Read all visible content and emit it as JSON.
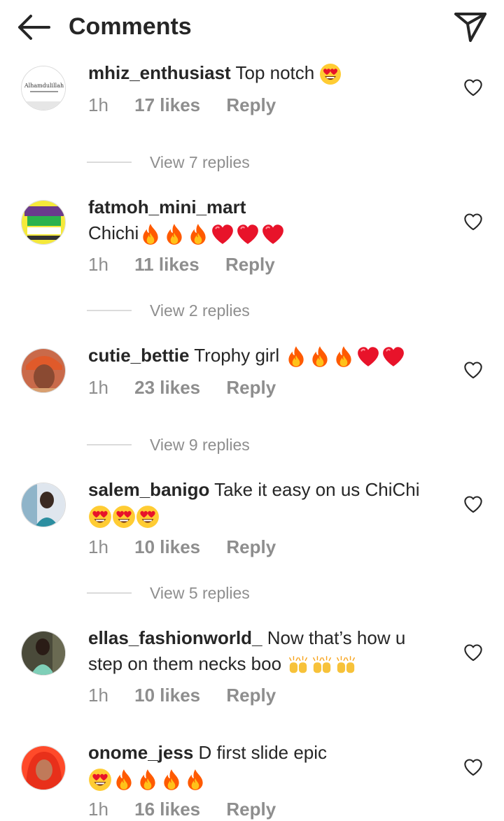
{
  "header": {
    "title": "Comments",
    "back_icon": "arrow-left-icon",
    "send_icon": "paper-plane-icon"
  },
  "comments": [
    {
      "username": "mhiz_enthusiast",
      "text": "Top notch",
      "emojis": [
        "heart-eyes"
      ],
      "time": "1h",
      "likes": "17 likes",
      "reply": "Reply",
      "view_replies": "View 7 replies"
    },
    {
      "username": "fatmoh_mini_mart",
      "text": "Chichi",
      "emojis": [
        "fire",
        "fire",
        "fire",
        "red-heart",
        "red-heart",
        "red-heart"
      ],
      "time": "1h",
      "likes": "11 likes",
      "reply": "Reply",
      "view_replies": "View 2 replies"
    },
    {
      "username": "cutie_bettie",
      "text": "Trophy girl",
      "emojis": [
        "fire",
        "fire",
        "fire",
        "red-heart",
        "red-heart"
      ],
      "time": "1h",
      "likes": "23 likes",
      "reply": "Reply",
      "view_replies": "View 9 replies"
    },
    {
      "username": "salem_banigo",
      "text": "Take it easy on us ChiChi",
      "emojis": [
        "heart-eyes",
        "heart-eyes",
        "heart-eyes"
      ],
      "time": "1h",
      "likes": "10 likes",
      "reply": "Reply",
      "view_replies": "View 5 replies"
    },
    {
      "username": "ellas_fashionworld_",
      "text": "Now that’s how u step on them necks boo",
      "emojis": [
        "raising-hands",
        "raising-hands",
        "raising-hands"
      ],
      "time": "1h",
      "likes": "10 likes",
      "reply": "Reply"
    },
    {
      "username": "onome_jess",
      "text": "D first slide epic",
      "emojis": [
        "heart-eyes",
        "fire",
        "fire",
        "fire",
        "fire"
      ],
      "time": "1h",
      "likes": "16 likes",
      "reply": "Reply"
    }
  ],
  "avatars": {
    "mhiz_enthusiast": "Alhamdulillah"
  },
  "colors": {
    "text": "#262626",
    "secondary": "#8e8e8e",
    "divider": "#dbdbdb",
    "heart_red": "#e8132a",
    "fire_orange": "#ff6a00"
  }
}
